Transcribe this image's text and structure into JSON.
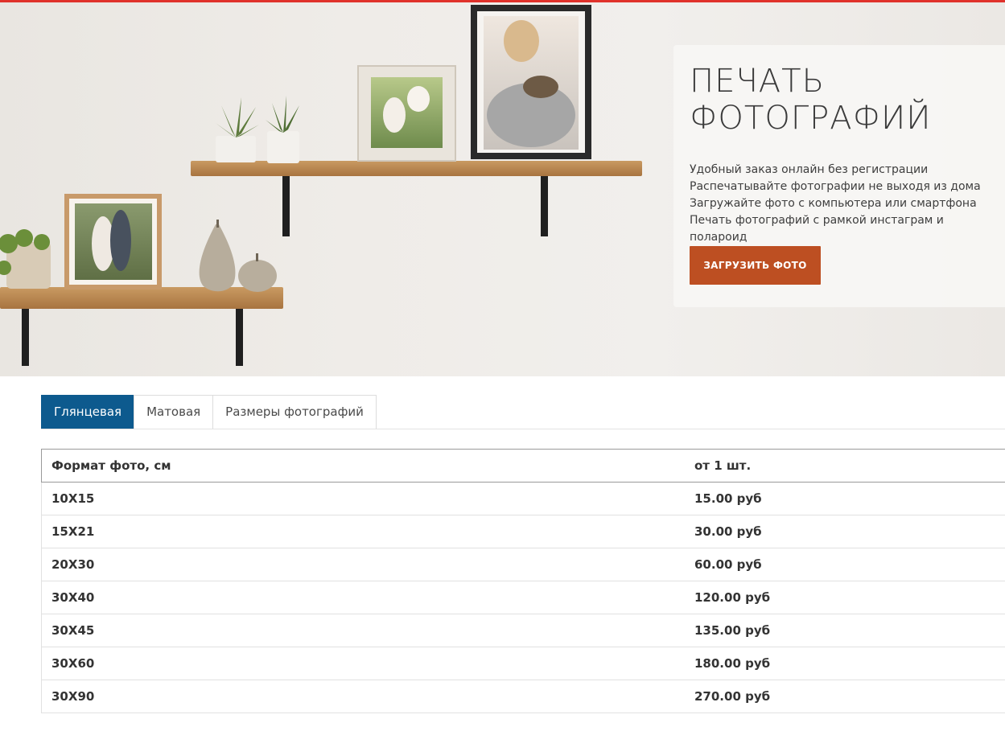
{
  "hero": {
    "title_line1": "ПЕЧАТЬ",
    "title_line2": "ФОТОГРАФИЙ",
    "features": [
      "Удобный заказ онлайн без регистрации",
      "Распечатывайте фотографии не выходя из дома",
      "Загружайте фото с компьютера или смартфона",
      "Печать фотографий с рамкой инстаграм и полароид"
    ],
    "upload_button_label": "ЗАГРУЗИТЬ ФОТО"
  },
  "tabs": [
    {
      "label": "Глянцевая",
      "active": true
    },
    {
      "label": "Матовая",
      "active": false
    },
    {
      "label": "Размеры фотографий",
      "active": false
    }
  ],
  "price_table": {
    "columns": [
      "Формат фото, см",
      "от 1 шт."
    ],
    "rows": [
      {
        "format": "10X15",
        "price": "15.00 руб"
      },
      {
        "format": "15X21",
        "price": "30.00 руб"
      },
      {
        "format": "20X30",
        "price": "60.00 руб"
      },
      {
        "format": "30X40",
        "price": "120.00 руб"
      },
      {
        "format": "30X45",
        "price": "135.00 руб"
      },
      {
        "format": "30X60",
        "price": "180.00 руб"
      },
      {
        "format": "30X90",
        "price": "270.00 руб"
      }
    ]
  },
  "colors": {
    "accent_top_line": "#e0322b",
    "upload_button": "#bd4f22",
    "active_tab": "#0d5a8e"
  }
}
